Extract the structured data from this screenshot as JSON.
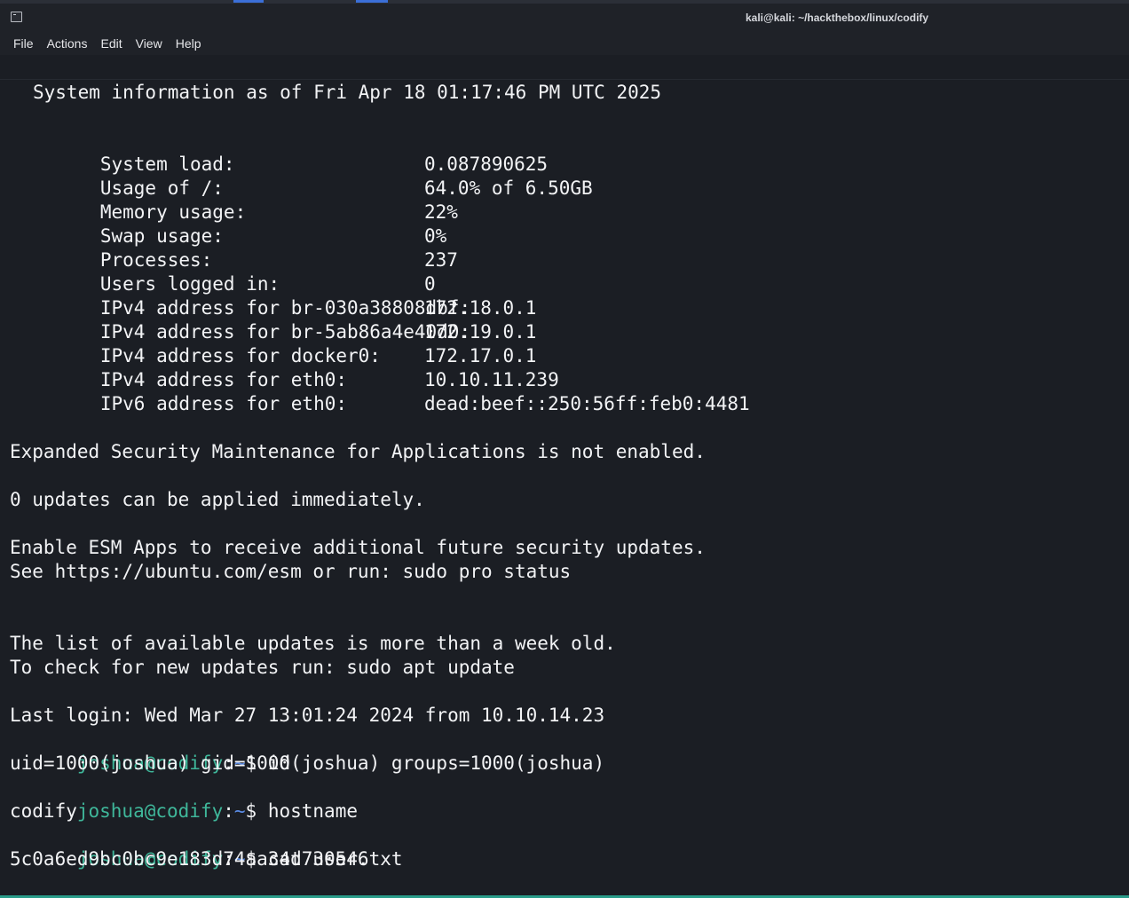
{
  "window": {
    "title": "kali@kali: ~/hackthebox/linux/codify"
  },
  "menu": {
    "items": [
      "File",
      "Actions",
      "Edit",
      "View",
      "Help"
    ]
  },
  "colors": {
    "background": "#1b1e24",
    "text": "#f2f3f5",
    "prompt_user": "#3fb79a",
    "prompt_path": "#5b8de8",
    "accent": "#3b6fd8"
  },
  "terminal": {
    "sysinfo_header": "System information as of Fri Apr 18 01:17:46 PM UTC 2025",
    "sysinfo": [
      {
        "label": "System load:",
        "value": "0.087890625"
      },
      {
        "label": "Usage of /:",
        "value": "64.0% of 6.50GB"
      },
      {
        "label": "Memory usage:",
        "value": "22%"
      },
      {
        "label": "Swap usage:",
        "value": "0%"
      },
      {
        "label": "Processes:",
        "value": "237"
      },
      {
        "label": "Users logged in:",
        "value": "0"
      },
      {
        "label": "IPv4 address for br-030a38808dbf:",
        "value": "172.18.0.1"
      },
      {
        "label": "IPv4 address for br-5ab86a4e40d0:",
        "value": "172.19.0.1"
      },
      {
        "label": "IPv4 address for docker0:",
        "value": "172.17.0.1"
      },
      {
        "label": "IPv4 address for eth0:",
        "value": "10.10.11.239"
      },
      {
        "label": "IPv6 address for eth0:",
        "value": "dead:beef::250:56ff:feb0:4481"
      }
    ],
    "esm_line": "Expanded Security Maintenance for Applications is not enabled.",
    "updates_line": "0 updates can be applied immediately.",
    "enable_esm_line": "Enable ESM Apps to receive additional future security updates.",
    "see_line": "See https://ubuntu.com/esm or run: sudo pro status",
    "list_old_line": "The list of available updates is more than a week old.",
    "check_line": "To check for new updates run: sudo apt update",
    "last_login_line": "Last login: Wed Mar 27 13:01:24 2024 from 10.10.14.23",
    "prompt": {
      "user_host": "joshua@codify",
      "colon": ":",
      "path": "~",
      "symbol": "$ "
    },
    "session": [
      {
        "command": "id",
        "output": "uid=1000(joshua) gid=1000(joshua) groups=1000(joshua)"
      },
      {
        "command": "hostname",
        "output": "codify"
      },
      {
        "command": "cat user.txt",
        "output": "5c0a6ed9bc0bc9e183d74aa34d730546"
      }
    ]
  }
}
